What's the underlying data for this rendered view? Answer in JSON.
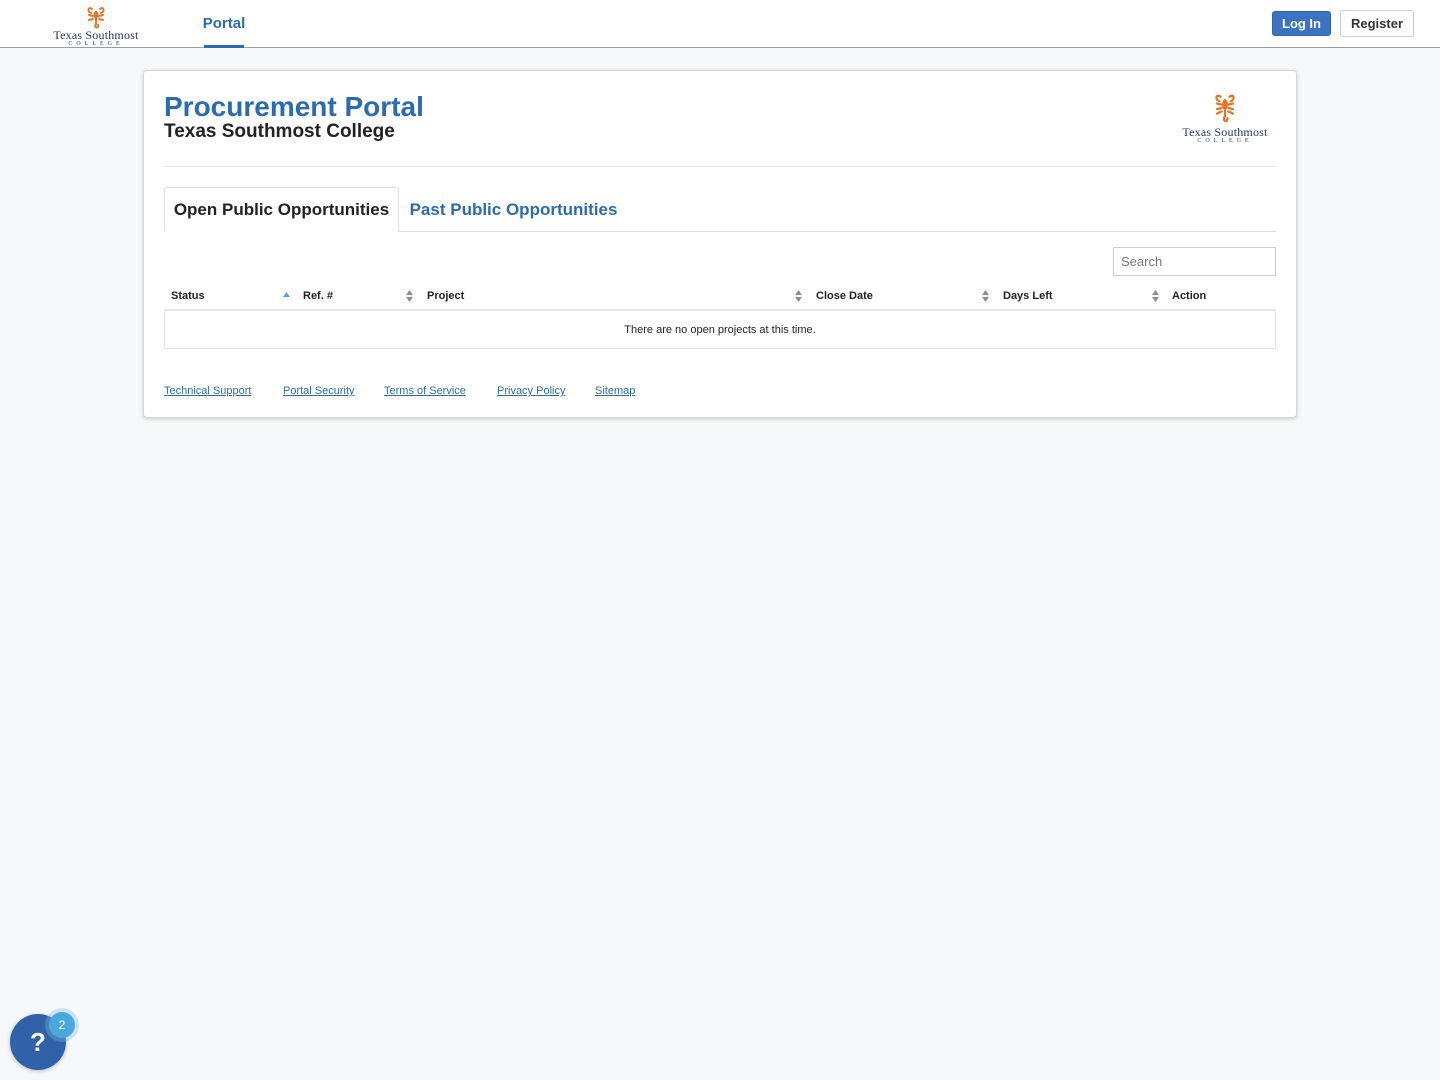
{
  "header": {
    "brand_name": "Texas Southmost",
    "brand_sub": "COLLEGE",
    "nav_portal": "Portal",
    "login_label": "Log In",
    "register_label": "Register"
  },
  "page": {
    "title": "Procurement Portal",
    "subtitle": "Texas Southmost College",
    "logo_name": "Texas Southmost",
    "logo_sub": "COLLEGE"
  },
  "tabs": [
    {
      "label": "Open Public Opportunities",
      "active": true
    },
    {
      "label": "Past Public Opportunities",
      "active": false
    }
  ],
  "search": {
    "placeholder": "Search"
  },
  "table": {
    "columns": [
      "Status",
      "Ref. #",
      "Project",
      "Close Date",
      "Days Left",
      "Action"
    ],
    "empty_message": "There are no open projects at this time."
  },
  "footer": {
    "links": [
      "Technical Support",
      "Portal Security",
      "Terms of Service",
      "Privacy Policy",
      "Sitemap"
    ]
  },
  "help": {
    "icon_text": "?",
    "badge_count": "2"
  },
  "colors": {
    "brand_blue": "#2b6cb0",
    "button_blue": "#3b73c0",
    "scorpion_orange": "#e8732a",
    "badge_blue": "#4aa9dc"
  },
  "icons": {
    "logo": "scorpion-logo-icon",
    "sort_asc": "sort-asc-icon",
    "sort_both": "sort-both-icon",
    "help": "help-question-icon"
  }
}
